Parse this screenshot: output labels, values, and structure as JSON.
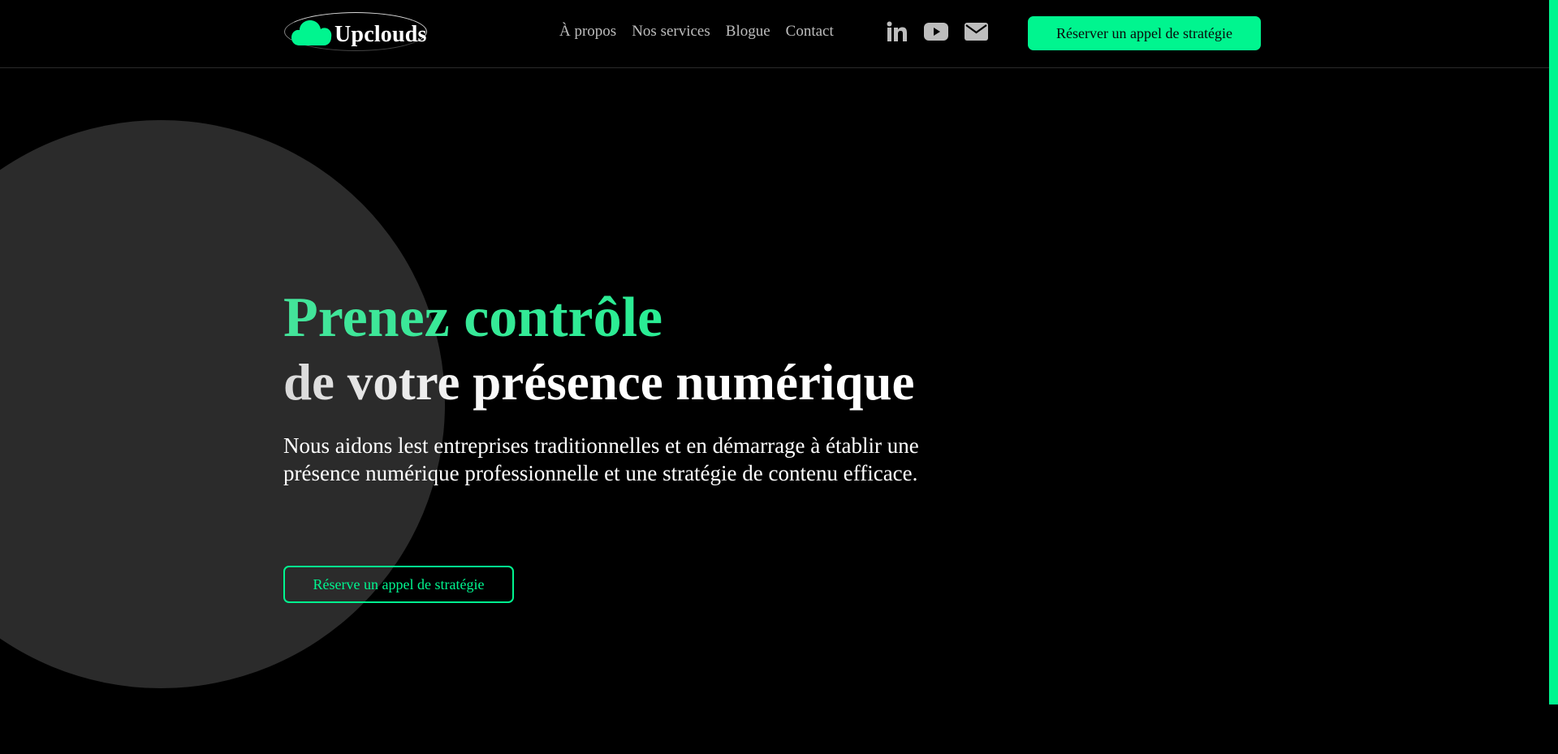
{
  "header": {
    "logo_text": "Upclouds",
    "logo_icon": "cloud-icon",
    "nav": [
      {
        "label": "À propos"
      },
      {
        "label": "Nos services"
      },
      {
        "label": "Blogue"
      },
      {
        "label": "Contact"
      }
    ],
    "social_icons": [
      "linkedin-icon",
      "youtube-icon",
      "mail-icon"
    ],
    "cta_label": "Réserver un appel de stratégie"
  },
  "hero": {
    "title_line1": "Prenez contrôle",
    "title_line2": "de votre présence numérique",
    "description": "Nous aidons lest entreprises traditionnelles et en démarrage à établir une présence numérique professionnelle et une stratégie de contenu efficace.",
    "cta_label": "Réserve un appel de stratégie"
  },
  "colors": {
    "background": "#000000",
    "accent": "#00f58f",
    "circle": "#2b2b2b",
    "nav_text": "#bdbdbd"
  }
}
